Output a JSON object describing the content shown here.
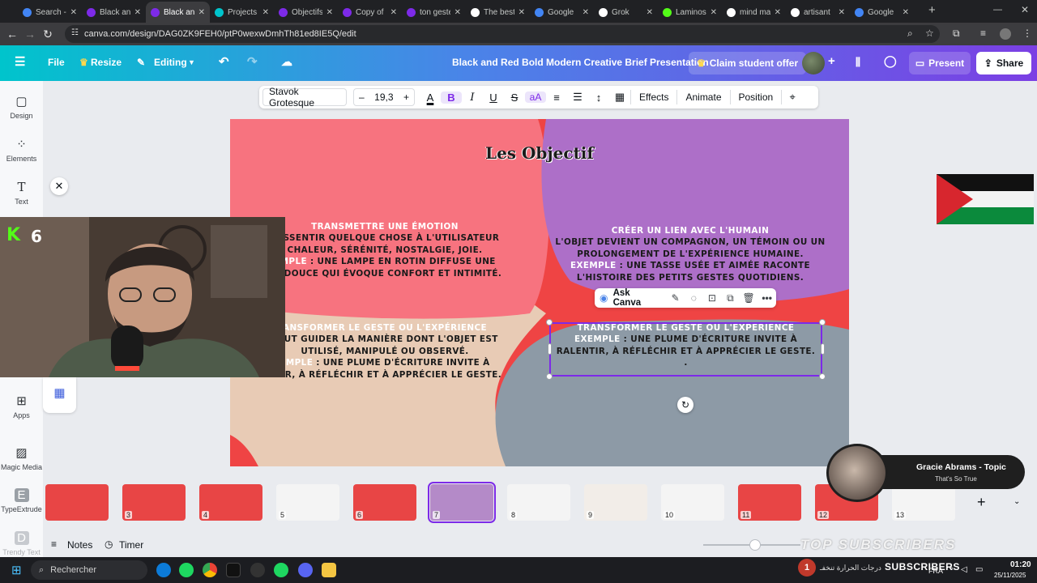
{
  "browser": {
    "tabs": [
      {
        "title": "Search -",
        "color": "#4285f4"
      },
      {
        "title": "Black an",
        "color": "#7d2ae8"
      },
      {
        "title": "Black an",
        "color": "#7d2ae8",
        "active": true
      },
      {
        "title": "Projects",
        "color": "#00c4cc"
      },
      {
        "title": "Objectifs",
        "color": "#7d2ae8"
      },
      {
        "title": "Copy of",
        "color": "#7d2ae8"
      },
      {
        "title": "ton geste",
        "color": "#7d2ae8"
      },
      {
        "title": "The best",
        "color": "#ffffff"
      },
      {
        "title": "Google",
        "color": "#4285f4"
      },
      {
        "title": "Grok",
        "color": "#ffffff"
      },
      {
        "title": "Laminos",
        "color": "#53fc18"
      },
      {
        "title": "mind ma",
        "color": "#ffffff"
      },
      {
        "title": "artisant",
        "color": "#ffffff"
      },
      {
        "title": "Google",
        "color": "#4285f4"
      }
    ],
    "url": "canva.com/design/DAG0ZK9FEH0/ptP0wexwDmhTh81ed8IE5Q/edit"
  },
  "header": {
    "file": "File",
    "resize": "Resize",
    "editing": "Editing",
    "doc_title": "Black and Red Bold Modern Creative Brief Presentation",
    "claim": "Claim student offer",
    "present": "Present",
    "share": "Share"
  },
  "rail": {
    "design": "Design",
    "elements": "Elements",
    "text": "Text",
    "apps": "Apps",
    "magic_media": "Magic Media",
    "typextrude": "TypeExtrude",
    "trendy_text": "Trendy Text"
  },
  "toolbar": {
    "font": "Stavok Grotesque",
    "minus": "–",
    "size": "19,3",
    "plus": "+",
    "effects": "Effects",
    "animate": "Animate",
    "position": "Position"
  },
  "slide": {
    "title": "Les Objectif",
    "block1": {
      "heading": "TRANSMETTRE UNE ÉMOTION",
      "l1": "RESSENTIR QUELQUE CHOSE À L'UTILISATEUR",
      "l2": "CHALEUR, SÉRÉNITÉ, NOSTALGIE, JOIE.",
      "l3a": "EMPLE",
      "l3b": " : UNE LAMPE EN ROTIN DIFFUSE UNE",
      "l4": "RE DOUCE QUI ÉVOQUE CONFORT ET INTIMITÉ."
    },
    "block2": {
      "heading": "CRÉER UN LIEN AVEC L'HUMAIN",
      "l1": "L'OBJET DEVIENT UN COMPAGNON, UN TÉMOIN OU UN",
      "l2": "PROLONGEMENT DE L'EXPÉRIENCE HUMAINE.",
      "l3a": "EXEMPLE",
      "l3b": " : UNE TASSE USÉE ET AIMÉE RACONTE",
      "l4": "L'HISTOIRE DES PETITS GESTES QUOTIDIENS."
    },
    "block3": {
      "heading": "ANSFORMER LE GESTE OU L'EXPÉRIENCE",
      "l1": "PEUT GUIDER LA MANIÈRE DONT L'OBJET EST",
      "l2": "UTILISÉ, MANIPULÉ OU OBSERVÉ.",
      "l3a": "EMPLE",
      "l3b": " : UNE PLUME D'ÉCRITURE INVITE À",
      "l4": "NTIR, À RÉFLÉCHIR ET À APPRÉCIER LE GESTE."
    },
    "block4": {
      "heading": "TRANSFORMER LE GESTE OU L'EXPÉRIENCE",
      "l1a": "EXEMPLE",
      "l1b": " : UNE PLUME D'ÉCRITURE INVITE À",
      "l2": "RALENTIR, À RÉFLÉCHIR ET À APPRÉCIER LE GESTE.",
      "l3": "."
    }
  },
  "ask_canva": "Ask Canva",
  "webcam": {
    "kick_logo": "K",
    "count": "6"
  },
  "pages": [
    {
      "n": ""
    },
    {
      "n": "3"
    },
    {
      "n": "4"
    },
    {
      "n": "5"
    },
    {
      "n": "6"
    },
    {
      "n": "7",
      "selected": true
    },
    {
      "n": "8"
    },
    {
      "n": "9"
    },
    {
      "n": "10"
    },
    {
      "n": "11"
    },
    {
      "n": "12"
    },
    {
      "n": "13"
    }
  ],
  "music": {
    "title": "Gracie Abrams - Topic",
    "subtitle": "That's So True"
  },
  "bottom": {
    "notes": "Notes",
    "timer": "Timer",
    "overlay": "TOP SUBSCRIBERS",
    "subscribers": "SUBSCRIBERS"
  },
  "taskbar": {
    "search": "Rechercher",
    "notif_count": "1",
    "notif_text": "درجات الحرارة تنخفـ",
    "lang": "FRA",
    "time": "01:20",
    "date": "25/11/2025"
  }
}
